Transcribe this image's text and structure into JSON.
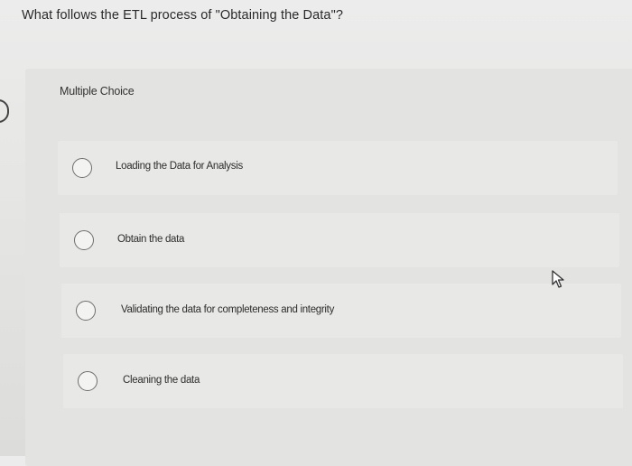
{
  "question": {
    "text": "What follows the ETL process of \"Obtaining the Data\"?"
  },
  "question_type": "Multiple Choice",
  "choices": [
    {
      "label": "Loading the Data for Analysis",
      "selected": false
    },
    {
      "label": "Obtain the data",
      "selected": false
    },
    {
      "label": "Validating the data for completeness and integrity",
      "selected": false
    },
    {
      "label": "Cleaning the data",
      "selected": false
    }
  ],
  "icons": {
    "cursor": "mouse-pointer-icon"
  }
}
